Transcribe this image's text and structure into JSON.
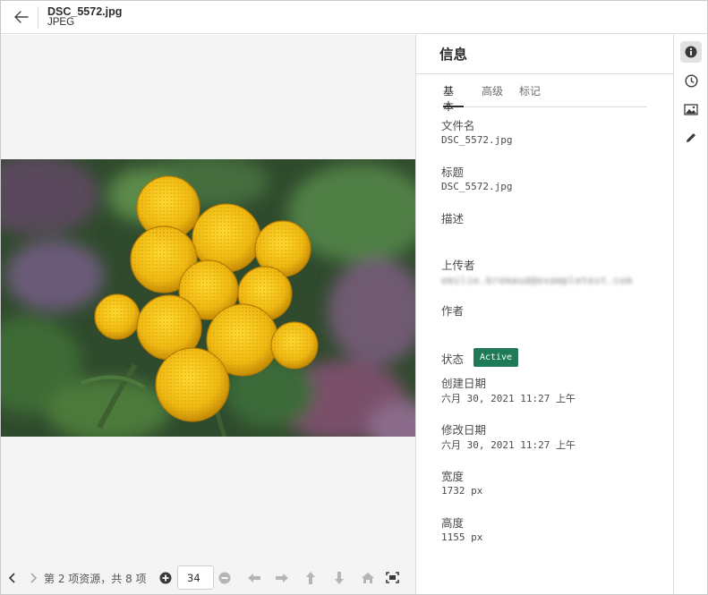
{
  "header": {
    "back_icon": "arrow-left-icon",
    "title": "DSC_5572.jpg",
    "subtitle": "JPEG"
  },
  "viewer": {
    "image_subject": "yellow tansy flowers",
    "pager": {
      "label": "第 2 项资源，共 8 项",
      "zoom_value": "34",
      "icons": [
        "chevron-left-icon",
        "chevron-right-icon",
        "zoom-in-icon",
        "zoom-out-icon",
        "rotate-left-icon",
        "rotate-right-icon",
        "flip-up-icon",
        "flip-down-icon",
        "home-icon",
        "fit-screen-icon"
      ]
    }
  },
  "info_panel": {
    "title": "信息",
    "tabs": [
      {
        "label": "基本",
        "active": true
      },
      {
        "label": "高级",
        "active": false
      },
      {
        "label": "标记",
        "active": false
      }
    ],
    "fields": {
      "filename": {
        "label": "文件名",
        "value": "DSC_5572.jpg"
      },
      "title": {
        "label": "标题",
        "value": "DSC_5572.jpg"
      },
      "description": {
        "label": "描述",
        "value": ""
      },
      "uploader": {
        "label": "上传者",
        "value": "emilie.bremaud@exampletest.com"
      },
      "author": {
        "label": "作者",
        "value": ""
      },
      "status": {
        "label": "状态",
        "value": "Active"
      },
      "created": {
        "label": "创建日期",
        "value": "六月 30, 2021 11:27 上午"
      },
      "modified": {
        "label": "修改日期",
        "value": "六月 30, 2021 11:27 上午"
      },
      "width": {
        "label": "宽度",
        "value": "1732 px"
      },
      "height": {
        "label": "高度",
        "value": "1155 px"
      }
    }
  },
  "rail": {
    "icons": [
      "info-icon",
      "history-icon",
      "image-icon",
      "pencil-icon"
    ],
    "active": "info-icon"
  },
  "colors": {
    "status_active": "#1f7a57",
    "viewer_bg": "#f4f4f4",
    "flower": "#f2c21a"
  }
}
